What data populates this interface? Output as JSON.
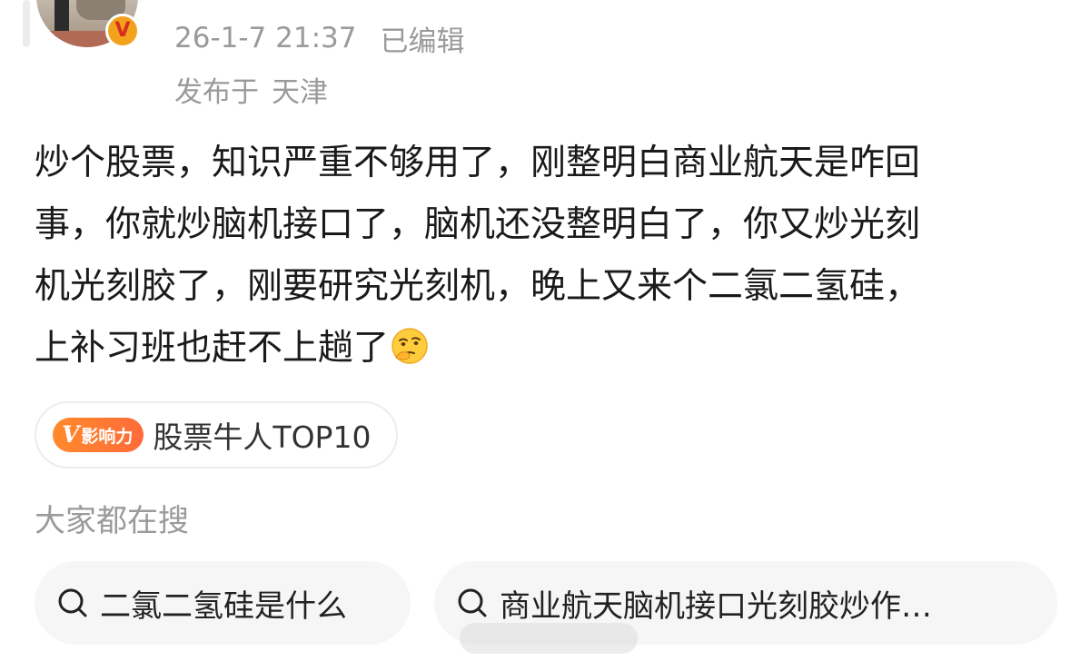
{
  "post": {
    "author_badge": "V",
    "timestamp": "26-1-7 21:37",
    "edited_label": "已编辑",
    "published_label": "发布于",
    "location": "天津",
    "content_lines": [
      "炒个股票，知识严重不够用了，刚整明白商业航天是咋回",
      "事，你就炒脑机接口了，脑机还没整明白了，你又炒光刻",
      "机光刻胶了，刚要研究光刻机，晚上又来个二氯二氢硅，",
      "上补习班也赶不上趟了"
    ],
    "trailing_emoji": "thinking-face-emoji"
  },
  "influence": {
    "badge_v": "V",
    "badge_text": "影响力",
    "label": "股票牛人TOP10"
  },
  "search": {
    "title": "大家都在搜",
    "items": [
      {
        "label": "二氯二氢硅是什么",
        "icon": "search-icon"
      },
      {
        "label": "商业航天脑机接口光刻胶炒作…",
        "icon": "search-icon"
      }
    ]
  },
  "colors": {
    "accent_orange": "#ff7a2e",
    "verified_gold": "#f3a21b",
    "verified_red": "#d92c20",
    "meta_gray": "#9a9a9a",
    "pill_background": "#f6f6f6"
  }
}
